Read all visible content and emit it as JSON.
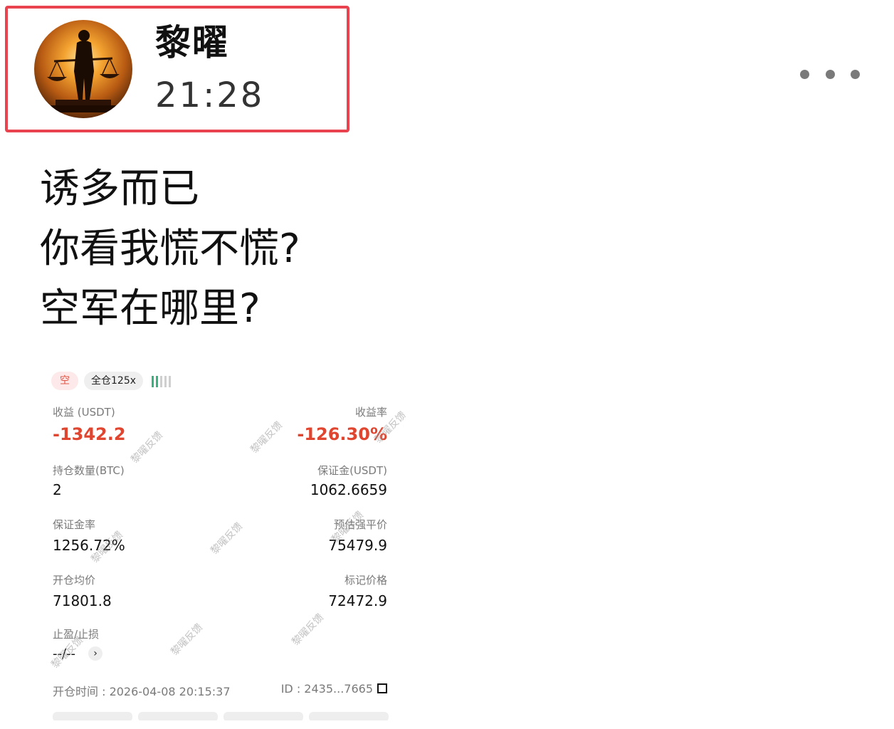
{
  "post": {
    "author": "黎曜",
    "time": "21:28",
    "lines": [
      "诱多而已",
      "你看我慌不慌?",
      "空军在哪里?"
    ]
  },
  "avatar": {
    "icon": "balance-scale-person-avatar",
    "caption": "黎曜"
  },
  "screenshot": {
    "direction_tag": "空",
    "mode_tag": "全仓125x",
    "pnl_label": "收益 (USDT)",
    "pnl_value": "-1342.2",
    "roi_label": "收益率",
    "roi_value": "-126.30%",
    "size_label": "持仓数量(BTC)",
    "size_value": "2",
    "margin_label": "保证金(USDT)",
    "margin_value": "1062.6659",
    "margin_ratio_label": "保证金率",
    "margin_ratio_value": "1256.72%",
    "liq_label": "预估强平价",
    "liq_value": "75479.9",
    "entry_label": "开仓均价",
    "entry_value": "71801.8",
    "mark_label": "标记价格",
    "mark_value": "72472.9",
    "tpsl_label": "止盈/止损",
    "tpsl_value": "--/--",
    "open_time": "开仓时间 : 2026-04-08 20:15:37",
    "id_text": "ID : 2435...7665",
    "watermark": "黎曜反馈"
  },
  "colors": {
    "highlight_border": "#e8434f",
    "loss_red": "#e0452f",
    "leverage_green": "#36b37e"
  }
}
